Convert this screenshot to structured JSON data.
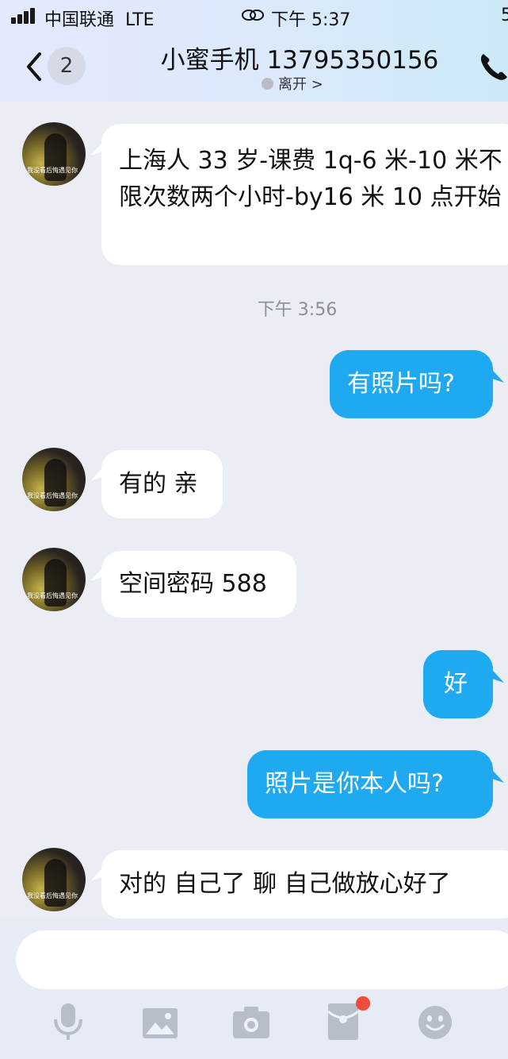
{
  "status_bar": {
    "carrier": "中国联通",
    "network": "LTE",
    "time": "下午 5:37",
    "battery_partial": "5"
  },
  "header": {
    "unread_count": "2",
    "title": "小蜜手机 13795350156",
    "presence": "离开 >"
  },
  "avatar_caption": "我没看后悔遇见你",
  "messages": [
    {
      "side": "in",
      "text": "上海人 33 岁-课费 1q-6 米-10 米不限次数两个小时-by16 米 10 点开始"
    },
    {
      "side": "out",
      "text": "有照片吗?"
    },
    {
      "side": "in",
      "text": "有的 亲"
    },
    {
      "side": "in",
      "text": "空间密码 588"
    },
    {
      "side": "out",
      "text": "好"
    },
    {
      "side": "out",
      "text": "照片是你本人吗?"
    },
    {
      "side": "in",
      "text": "对的 自己了 聊 自己做放心好了"
    }
  ],
  "timestamp": "下午 3:56",
  "toolbar_icons": [
    "microphone-icon",
    "image-icon",
    "camera-icon",
    "red-packet-icon",
    "emoji-icon"
  ],
  "colors": {
    "accent": "#1ea9f0",
    "background": "#eaedf4",
    "notification_dot": "#f24a3d"
  }
}
